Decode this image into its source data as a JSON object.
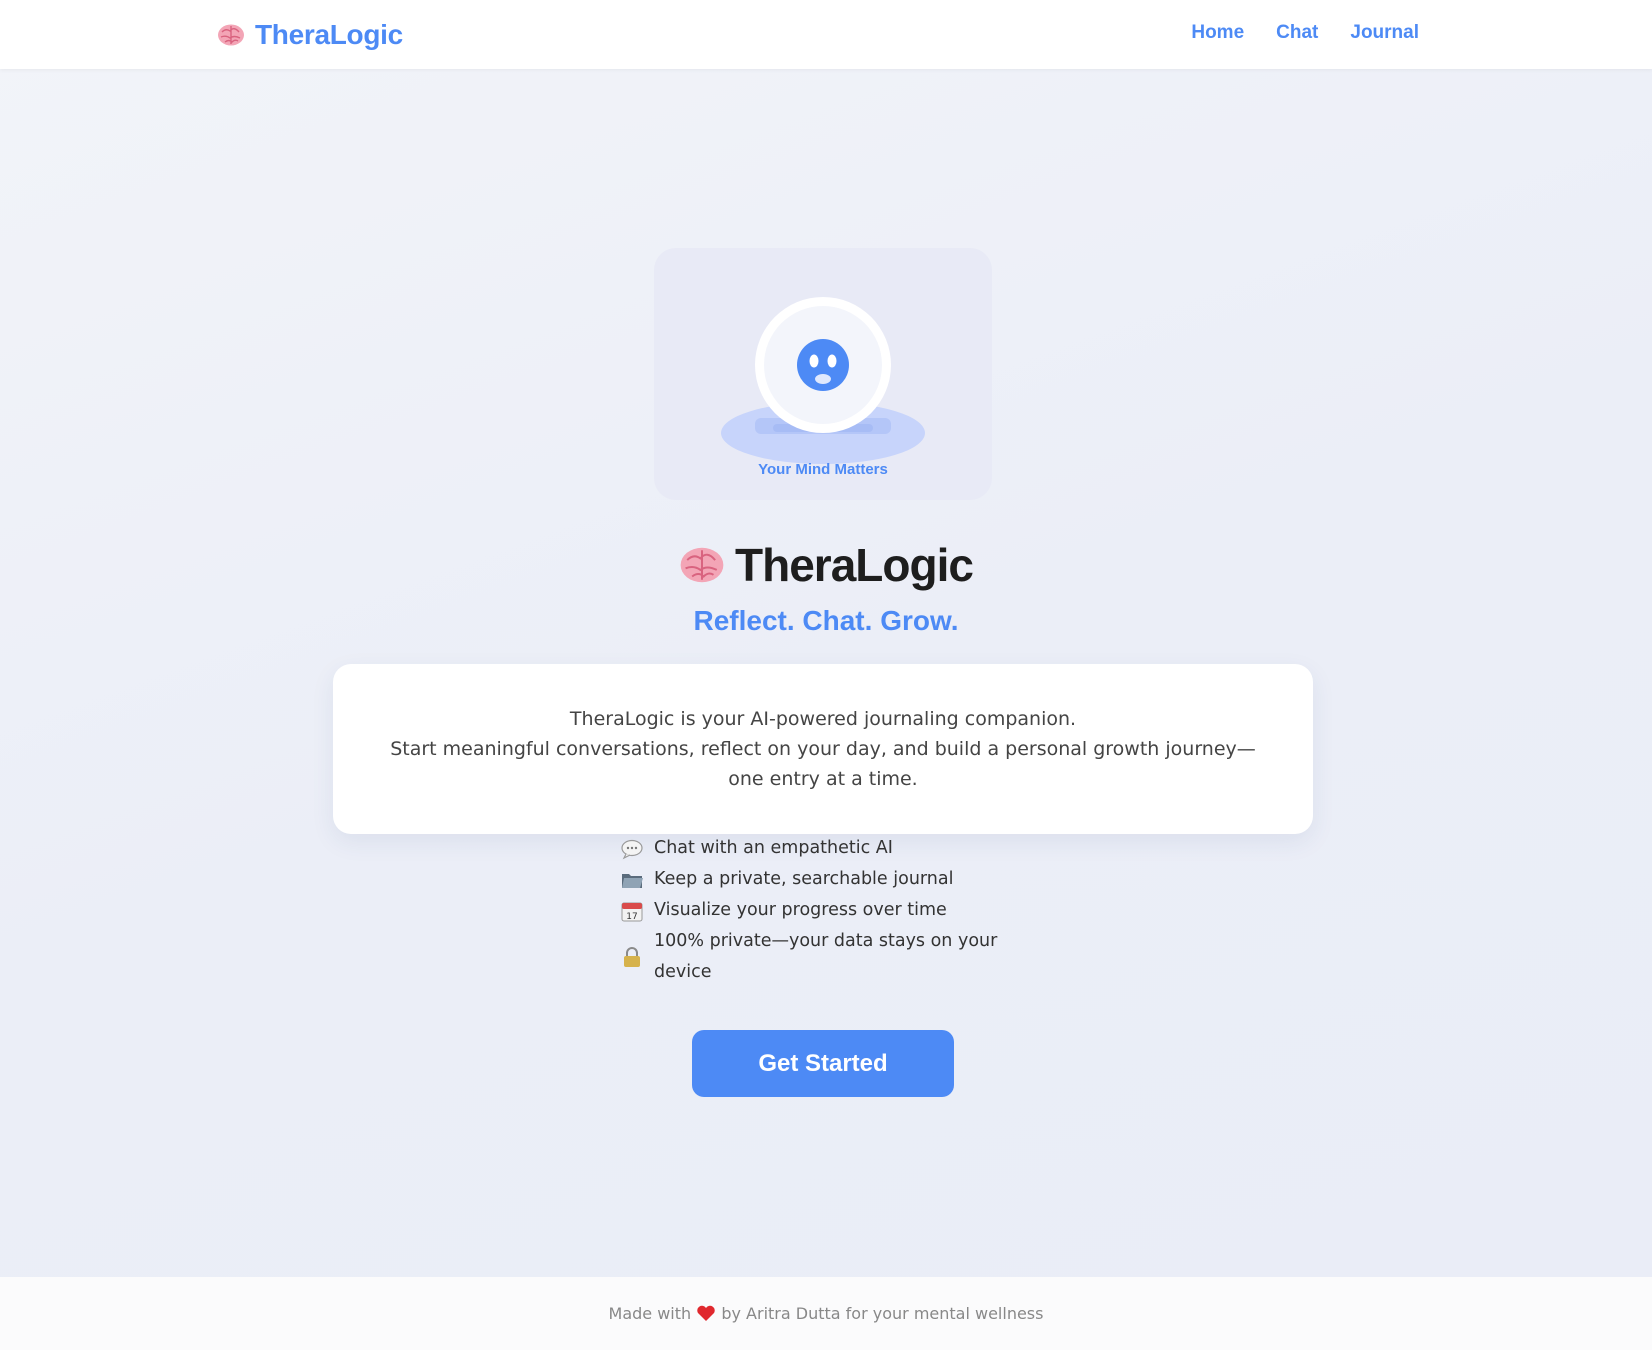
{
  "nav": {
    "brand": "TheraLogic",
    "brand_icon": "brain-icon",
    "links": [
      {
        "label": "Home"
      },
      {
        "label": "Chat"
      },
      {
        "label": "Journal"
      }
    ]
  },
  "hero": {
    "illustration_caption": "Your Mind Matters",
    "title": "TheraLogic",
    "tagline": "Reflect. Chat. Grow.",
    "description_line1": "TheraLogic is your AI-powered journaling companion.",
    "description_line2": "Start meaningful conversations, reflect on your day, and build a personal growth journey—one entry at a time."
  },
  "features": [
    {
      "icon": "speech-bubble-icon",
      "text": "Chat with an empathetic AI"
    },
    {
      "icon": "folder-icon",
      "text": "Keep a private, searchable journal"
    },
    {
      "icon": "calendar-icon",
      "text": "Visualize your progress over time"
    },
    {
      "icon": "lock-icon",
      "text": "100% private—your data stays on your device"
    }
  ],
  "cta": {
    "label": "Get Started"
  },
  "footer": {
    "prefix": "Made with",
    "suffix": "by Aritra Dutta for your mental wellness",
    "icon": "heart-icon"
  },
  "colors": {
    "accent": "#4d8af5",
    "background": "#eceff8",
    "card": "#ffffff",
    "illustration_bg": "#e8eaf6"
  }
}
